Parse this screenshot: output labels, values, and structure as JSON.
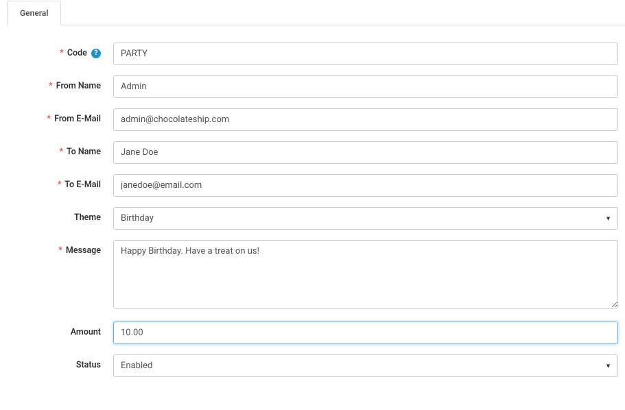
{
  "tab": {
    "general": "General"
  },
  "labels": {
    "code": "Code",
    "from_name": "From Name",
    "from_email": "From E-Mail",
    "to_name": "To Name",
    "to_email": "To E-Mail",
    "theme": "Theme",
    "message": "Message",
    "amount": "Amount",
    "status": "Status"
  },
  "values": {
    "code": "PARTY",
    "from_name": "Admin",
    "from_email": "admin@chocolateship.com",
    "to_name": "Jane Doe",
    "to_email": "janedoe@email.com",
    "theme": "Birthday",
    "message": "Happy Birthday. Have a treat on us!",
    "amount": "10.00",
    "status": "Enabled"
  },
  "help": {
    "code": "?"
  }
}
